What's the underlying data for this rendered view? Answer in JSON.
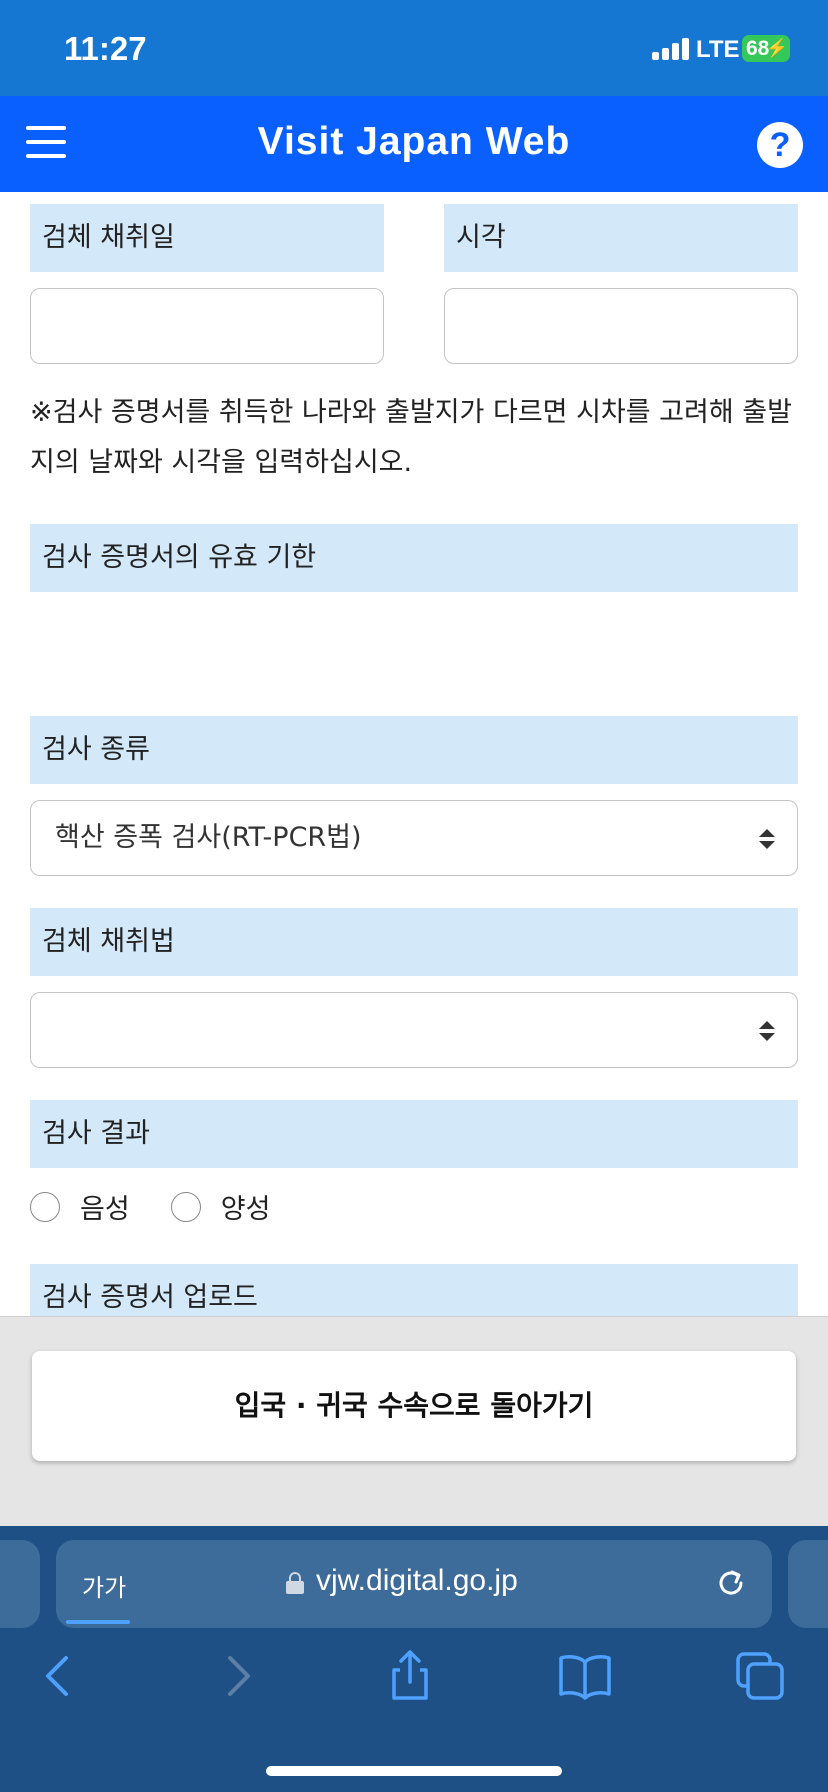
{
  "status_bar": {
    "time": "11:27",
    "network": "LTE",
    "battery": "68"
  },
  "header": {
    "title": "Visit Japan Web",
    "help": "?"
  },
  "form": {
    "collection_date_label": "검체 채취일",
    "time_label": "시각",
    "collection_date_value": "",
    "time_value": "",
    "note": "※검사 증명서를 취득한 나라와 출발지가 다르면 시차를 고려해 출발지의 날짜와 시각을 입력하십시오.",
    "validity_label": "검사 증명서의 유효 기한",
    "test_type_label": "검사 종류",
    "test_type_value": "핵산 증폭 검사(RT-PCR법)",
    "sample_method_label": "검체 채취법",
    "sample_method_value": "",
    "result_label": "검사 결과",
    "result_options": [
      "음성",
      "양성"
    ],
    "upload_label": "검사 증명서 업로드"
  },
  "bottom": {
    "return_button": "입국 · 귀국 수속으로 돌아가기"
  },
  "browser": {
    "aa": "가가",
    "url": "vjw.digital.go.jp"
  },
  "colors": {
    "header": "#0a5fff",
    "status": "#1677d2",
    "label_band": "#d3e8f8",
    "browser": "#1f5085"
  }
}
